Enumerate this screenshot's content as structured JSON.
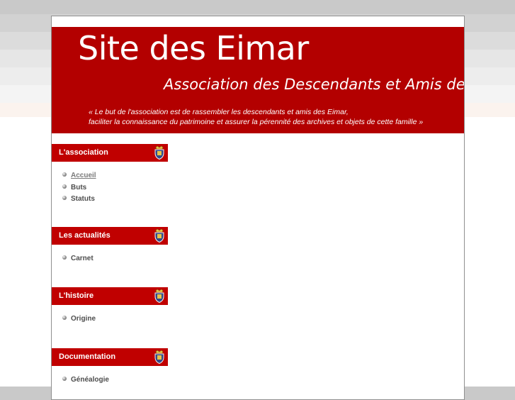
{
  "banner": {
    "title": "Site des Eimar",
    "subtitle": "Association des Descendants et Amis de",
    "motto_line1": "« Le but de l'association est de rassembler les descendants et amis des Eimar,",
    "motto_line2": "faciliter la connaissance du patrimoine et assurer la pérennité des archives et objets de cette famille »"
  },
  "sidebar": {
    "sections": [
      {
        "title": "L'association",
        "items": [
          "Accueil",
          "Buts",
          "Statuts"
        ]
      },
      {
        "title": "Les actualités",
        "items": [
          "Carnet"
        ]
      },
      {
        "title": "L'histoire",
        "items": [
          "Origine"
        ]
      },
      {
        "title": "Documentation",
        "items": [
          "Généalogie"
        ]
      }
    ],
    "crest_icon": "family-crest-icon"
  },
  "colors": {
    "banner_red": "#b30000",
    "header_red": "#c00000",
    "link_grey": "#4d4d4d"
  }
}
